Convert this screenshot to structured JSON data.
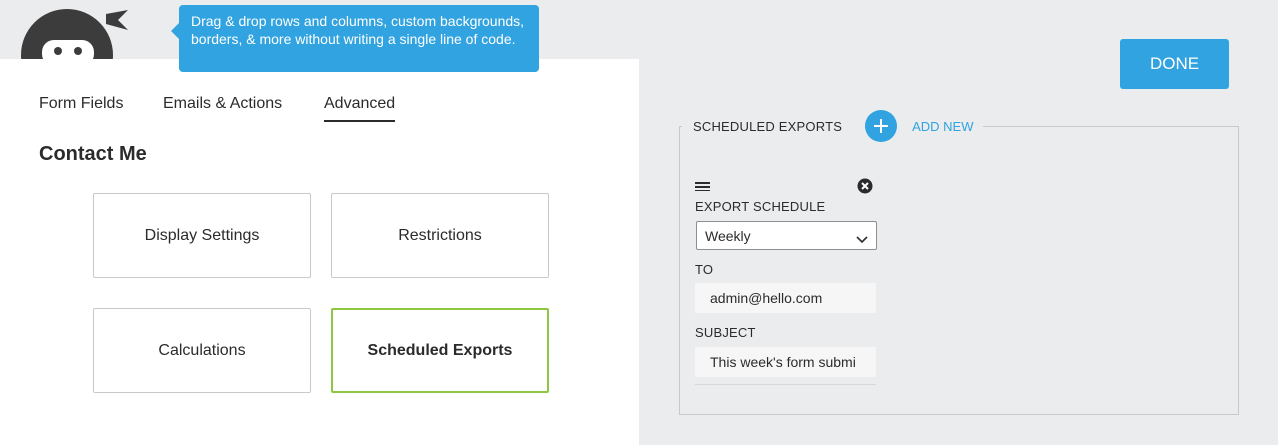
{
  "tooltip": {
    "text": "Drag & drop rows and columns, custom backgrounds, borders, & more without writing a single line of code."
  },
  "tabs": [
    {
      "label": "Form Fields",
      "active": false
    },
    {
      "label": "Emails & Actions",
      "active": false
    },
    {
      "label": "Advanced",
      "active": true
    }
  ],
  "form_title": "Contact Me",
  "cards": [
    {
      "label": "Display Settings",
      "selected": false
    },
    {
      "label": "Restrictions",
      "selected": false
    },
    {
      "label": "Calculations",
      "selected": false
    },
    {
      "label": "Scheduled Exports",
      "selected": true
    }
  ],
  "drawer": {
    "done_label": "DONE",
    "section_title": "SCHEDULED EXPORTS",
    "add_new_label": "ADD NEW",
    "export_item": {
      "schedule_label": "EXPORT SCHEDULE",
      "schedule_value": "Weekly",
      "to_label": "TO",
      "to_value": "admin@hello.com",
      "subject_label": "SUBJECT",
      "subject_value": "This week's form submi"
    }
  },
  "colors": {
    "accent": "#30a3e0",
    "selected_border": "#8dc63f",
    "drawer_bg": "#ebecee"
  },
  "icons": [
    "ninja-logo",
    "plus-icon",
    "drag-handle-icon",
    "close-circle-icon",
    "chevron-down-icon"
  ]
}
